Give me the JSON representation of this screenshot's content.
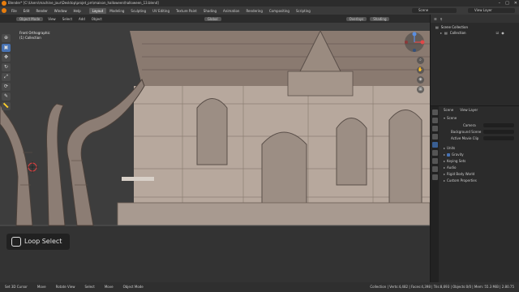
{
  "window": {
    "title": "Blender* [C:\\Users\\machine_jour\\Desktop\\projet_pm\\maison_halloween\\halloween_13.blend]",
    "controls": [
      "–",
      "□",
      "✕"
    ]
  },
  "menus": [
    "File",
    "Edit",
    "Render",
    "Window",
    "Help"
  ],
  "workspaces": [
    "Layout",
    "Modeling",
    "Sculpting",
    "UV Editing",
    "Texture Paint",
    "Shading",
    "Animation",
    "Rendering",
    "Compositing",
    "Scripting"
  ],
  "active_workspace": "Layout",
  "scene": {
    "name": "Scene",
    "view_layer": "View Layer"
  },
  "viewport": {
    "header": {
      "mode": "Object Mode",
      "view": "View",
      "select": "Select",
      "add": "Add",
      "object": "Object",
      "orientation": "Global",
      "overlays": "Overlays",
      "shading": "Shading"
    },
    "info": {
      "view_name": "Front Orthographic",
      "collection": "(1) Collection"
    },
    "operator_overlay": "Loop Select",
    "tools": [
      "cursor",
      "move",
      "rotate",
      "scale",
      "transform",
      "annotate",
      "measure"
    ]
  },
  "outliner": {
    "root": "Scene Collection",
    "items": [
      "Collection"
    ]
  },
  "properties": {
    "tabs": [
      "Scene",
      "View Layer"
    ],
    "section": "Scene",
    "rows": [
      {
        "label": "Camera"
      },
      {
        "label": "Background Scene"
      },
      {
        "label": "Active Movie Clip"
      }
    ],
    "units_section": "Units",
    "gravity": "Gravity",
    "collapsed": [
      "Keying Sets",
      "Audio",
      "Rigid Body World",
      "Custom Properties"
    ]
  },
  "statusbar": {
    "select": "Set 3D Cursor",
    "move": "Move",
    "rotate": "Rotate View",
    "select2": "Select",
    "move2": "Move",
    "mode": "Object Mode",
    "stats": "Collection | Verts:4,482 | Faces:4,398 | Tris:8,693 | Objects:0/0 | Mem: 55.3 MiB | 2.80.75"
  },
  "colors": {
    "accent": "#4772b3",
    "logo": "#e87d0d",
    "viewport_bg": "#3d3d3d",
    "wall": "#b7a89d",
    "roof": "#8a7a70"
  }
}
